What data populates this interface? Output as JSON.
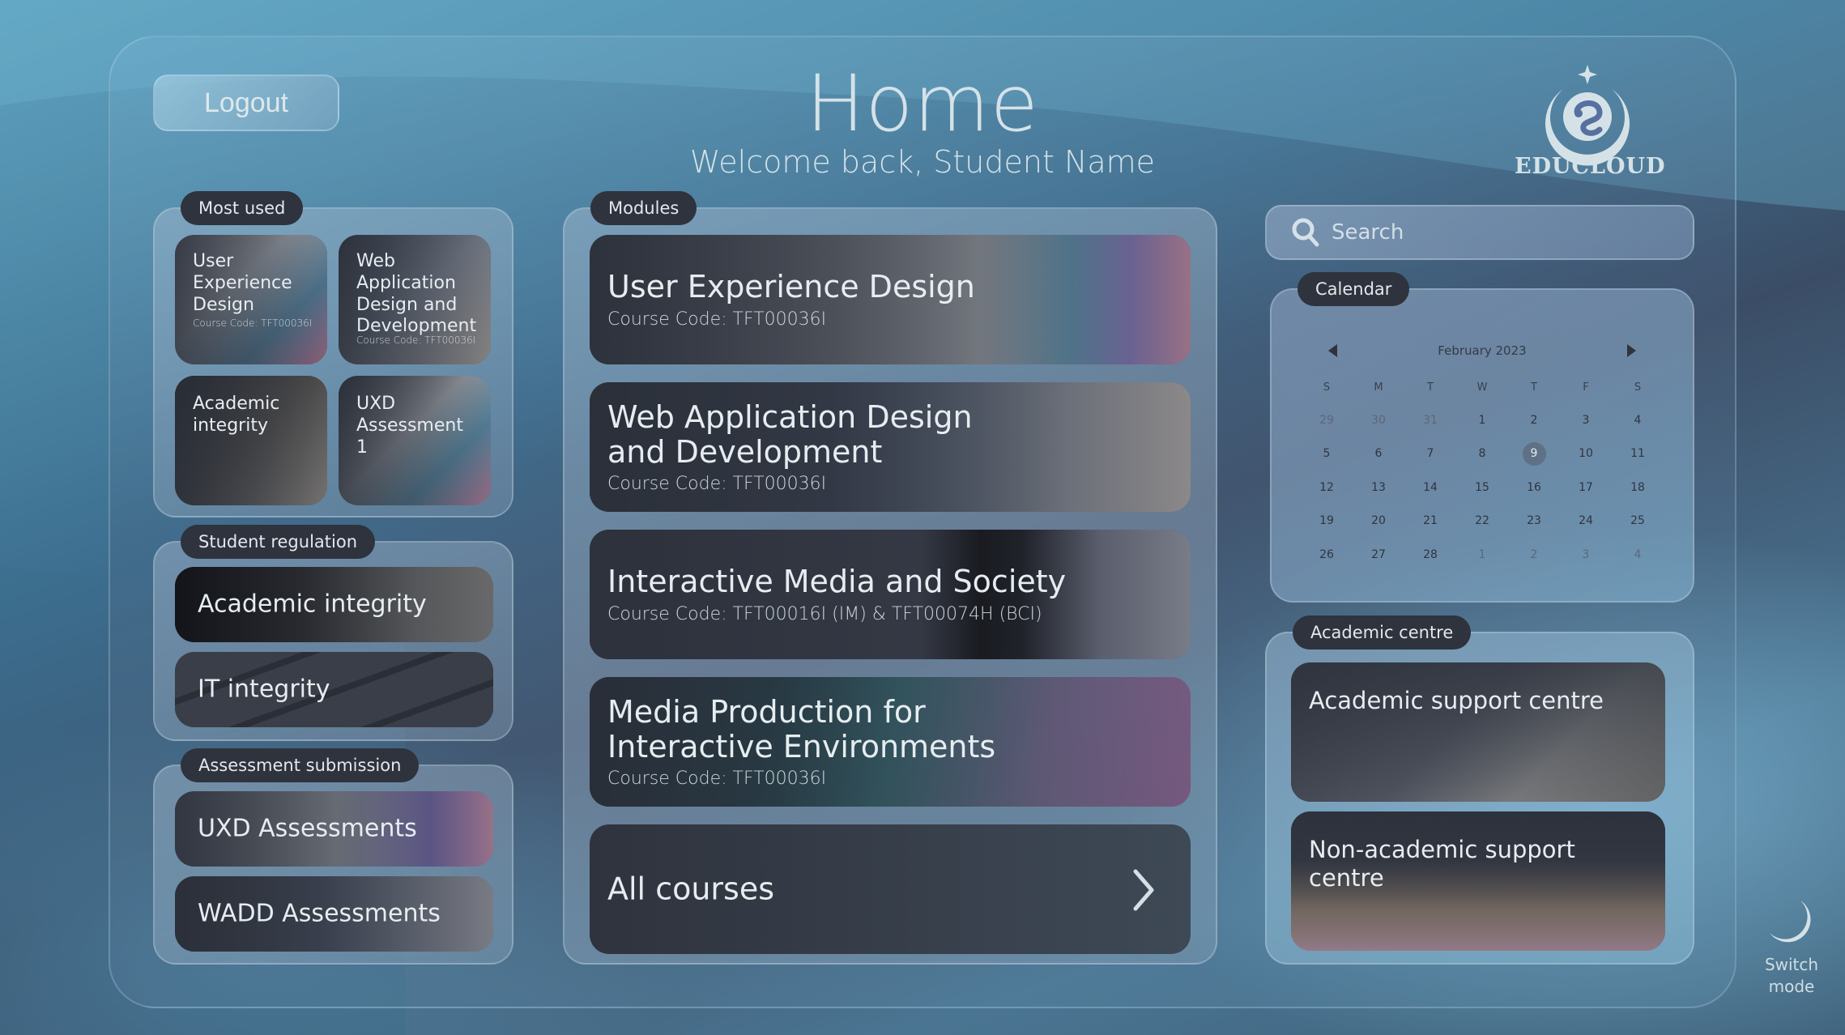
{
  "header": {
    "logout_label": "Logout",
    "title": "Home",
    "subtitle": "Welcome back, Student Name",
    "logo_text": "EDUCLOUD"
  },
  "most_used": {
    "label": "Most used",
    "items": [
      {
        "title": "User Experience Design",
        "code": "Course Code: TFT00036I"
      },
      {
        "title": "Web Application Design and Development",
        "code": "Course Code: TFT00036I"
      },
      {
        "title": "Academic integrity",
        "code": ""
      },
      {
        "title": "UXD Assessment 1",
        "code": ""
      }
    ]
  },
  "student_regulation": {
    "label": "Student regulation",
    "items": [
      {
        "title": "Academic integrity"
      },
      {
        "title": "IT integrity"
      }
    ]
  },
  "assessment_submission": {
    "label": "Assessment submission",
    "items": [
      {
        "title": "UXD Assessments"
      },
      {
        "title": "WADD Assessments"
      }
    ]
  },
  "modules": {
    "label": "Modules",
    "items": [
      {
        "title": "User Experience Design",
        "code": "Course Code: TFT00036I"
      },
      {
        "title": "Web Application Design and Development",
        "code": "Course Code: TFT00036I"
      },
      {
        "title": "Interactive Media and Society",
        "code": "Course Code: TFT00016I (IM) & TFT00074H (BCI)"
      },
      {
        "title": "Media Production for Interactive Environments",
        "code": "Course Code: TFT00036I"
      }
    ],
    "all_courses_label": "All courses"
  },
  "search": {
    "placeholder": "Search",
    "value": ""
  },
  "calendar": {
    "label": "Calendar",
    "month": "February 2023",
    "weekdays": [
      "S",
      "M",
      "T",
      "W",
      "T",
      "F",
      "S"
    ],
    "selected_day": "9",
    "weeks": [
      [
        {
          "d": "29",
          "m": true
        },
        {
          "d": "30",
          "m": true
        },
        {
          "d": "31",
          "m": true
        },
        {
          "d": "1"
        },
        {
          "d": "2"
        },
        {
          "d": "3"
        },
        {
          "d": "4"
        }
      ],
      [
        {
          "d": "5"
        },
        {
          "d": "6"
        },
        {
          "d": "7"
        },
        {
          "d": "8"
        },
        {
          "d": "9",
          "t": true
        },
        {
          "d": "10"
        },
        {
          "d": "11"
        }
      ],
      [
        {
          "d": "12"
        },
        {
          "d": "13"
        },
        {
          "d": "14"
        },
        {
          "d": "15"
        },
        {
          "d": "16"
        },
        {
          "d": "17"
        },
        {
          "d": "18"
        }
      ],
      [
        {
          "d": "19"
        },
        {
          "d": "20"
        },
        {
          "d": "21"
        },
        {
          "d": "22"
        },
        {
          "d": "23"
        },
        {
          "d": "24"
        },
        {
          "d": "25"
        }
      ],
      [
        {
          "d": "26"
        },
        {
          "d": "27"
        },
        {
          "d": "28"
        },
        {
          "d": "1",
          "m": true
        },
        {
          "d": "2",
          "m": true
        },
        {
          "d": "3",
          "m": true
        },
        {
          "d": "4",
          "m": true
        }
      ]
    ]
  },
  "academic_centre": {
    "label": "Academic centre",
    "items": [
      {
        "title": "Academic support centre"
      },
      {
        "title": "Non-academic support centre"
      }
    ]
  },
  "switch_mode": {
    "label_line1": "Switch",
    "label_line2": "mode",
    "icon": "moon-icon"
  },
  "colors": {
    "pill_bg": "#2e333d",
    "card_bg": "#343a45",
    "text_light": "#dfe9ee",
    "today_bg": "#5f7186"
  }
}
